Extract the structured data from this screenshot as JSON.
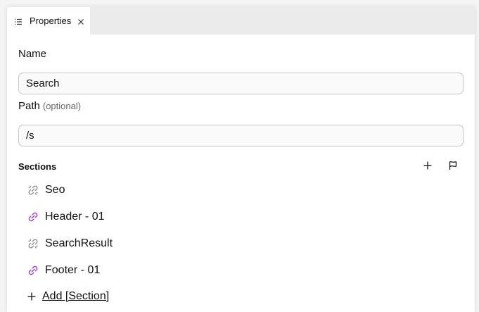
{
  "tab": {
    "label": "Properties",
    "icon": "list-icon",
    "close_icon": "close-icon"
  },
  "name_field": {
    "label": "Name",
    "value": "Search"
  },
  "path_field": {
    "label": "Path",
    "optional_hint": "(optional)",
    "value": "/s"
  },
  "sections": {
    "title": "Sections",
    "add_icon": "plus-icon",
    "flag_icon": "flag-icon",
    "items": [
      {
        "label": "Seo",
        "icon": "broken-link-icon"
      },
      {
        "label": "Header - 01",
        "icon": "link-icon"
      },
      {
        "label": "SearchResult",
        "icon": "broken-link-icon"
      },
      {
        "label": "Footer - 01",
        "icon": "link-icon"
      }
    ],
    "add_label": "Add [Section]"
  },
  "colors": {
    "link_icon": "#9b3fd6",
    "broken_link_icon": "#8a8a8a",
    "tabbar_bg": "#ebebeb"
  }
}
